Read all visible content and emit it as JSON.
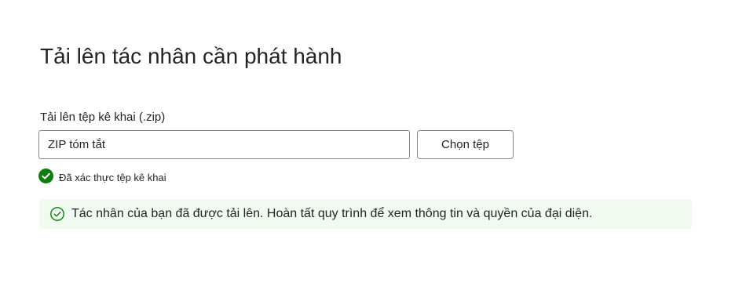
{
  "page": {
    "title": "Tải lên tác nhân cần phát hành"
  },
  "upload": {
    "label": "Tải lên tệp kê khai (.zip)",
    "file_value": "ZIP tóm tắt",
    "choose_button_label": "Chọn tệp"
  },
  "validation": {
    "icon": "checkmark-circle-filled-icon",
    "text": "Đã xác thực tệp kê khai"
  },
  "banner": {
    "icon": "checkmark-circle-outline-icon",
    "message": "Tác nhân của bạn đã được tải lên. Hoàn tất quy trình để xem thông tin và quyền của đại diện."
  },
  "colors": {
    "success_green": "#107c10",
    "banner_background": "#f1faf1",
    "border": "#8a8886",
    "text": "#242424"
  }
}
